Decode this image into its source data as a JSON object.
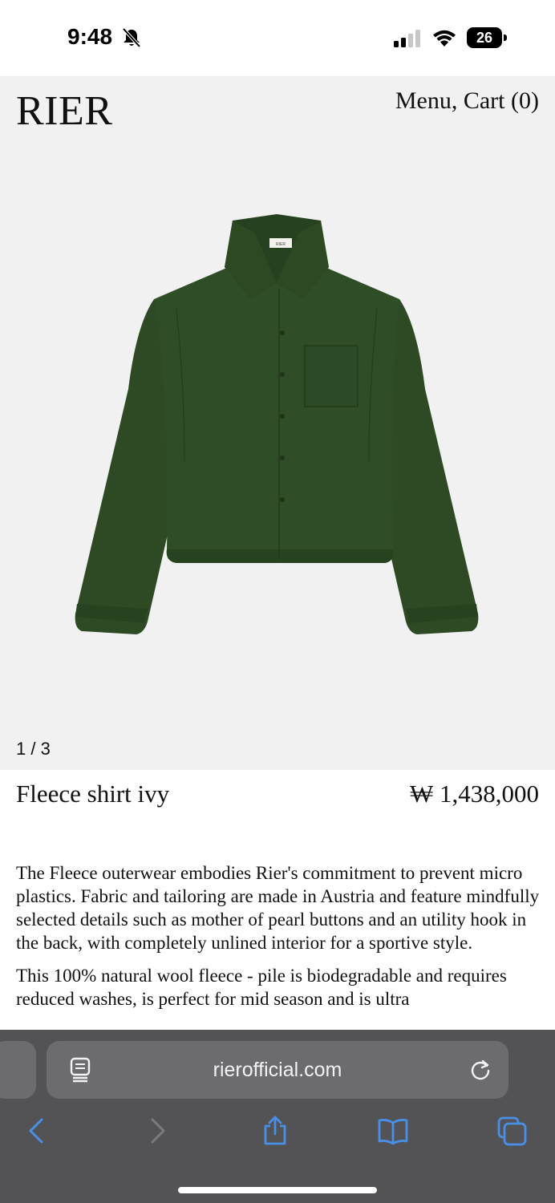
{
  "status_bar": {
    "time": "9:48",
    "battery": "26"
  },
  "header": {
    "brand": "RIER",
    "nav_menu": "Menu,",
    "nav_cart": "Cart (0)"
  },
  "gallery": {
    "counter": "1 / 3",
    "garment_label": "RIER"
  },
  "product": {
    "name": "Fleece shirt ivy",
    "price": "₩ 1,438,000",
    "description_1": "The Fleece outerwear embodies Rier's commitment to prevent micro plastics. Fabric and tailoring are made in Austria and feature mindfully selected details such as mother of pearl buttons and an utility hook in the back, with completely unlined interior for a sportive style.",
    "description_2": "This 100% natural wool fleece - pile is biodegradable and requires reduced washes, is perfect for mid season and is ultra"
  },
  "browser": {
    "url": "rierofficial.com",
    "icons": [
      "reader-icon",
      "reload-icon",
      "back-icon",
      "forward-icon",
      "share-icon",
      "bookmarks-icon",
      "tabs-icon"
    ]
  },
  "colors": {
    "page_bg": "#ffffff",
    "hero_bg": "#f1f1f1",
    "garment": "#2d4a25",
    "toolbar_bg": "#535356",
    "toolbar_field": "#6c6c70",
    "accent_blue": "#4a8fe6"
  }
}
